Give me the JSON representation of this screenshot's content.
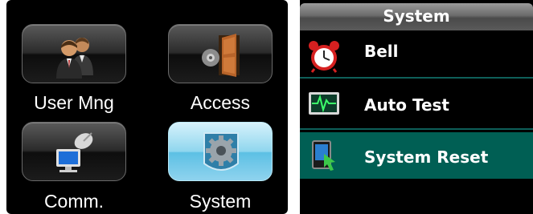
{
  "main_menu": {
    "items": [
      {
        "label": "User Mng",
        "icon": "users-icon"
      },
      {
        "label": "Access",
        "icon": "door-icon"
      },
      {
        "label": "Comm.",
        "icon": "satellite-computer-icon"
      },
      {
        "label": "System",
        "icon": "gear-icon"
      }
    ],
    "selected": "System"
  },
  "system_menu": {
    "title": "System",
    "items": [
      {
        "label": "Bell",
        "icon": "alarm-clock-icon"
      },
      {
        "label": "Auto Test",
        "icon": "heartbeat-monitor-icon"
      },
      {
        "label": "System Reset",
        "icon": "reset-device-icon"
      }
    ],
    "selected": "System Reset"
  },
  "colors": {
    "screen_bg": "#000000",
    "selected_row": "#005f54",
    "selected_tile": "#8fd6ee",
    "text": "#ffffff"
  }
}
